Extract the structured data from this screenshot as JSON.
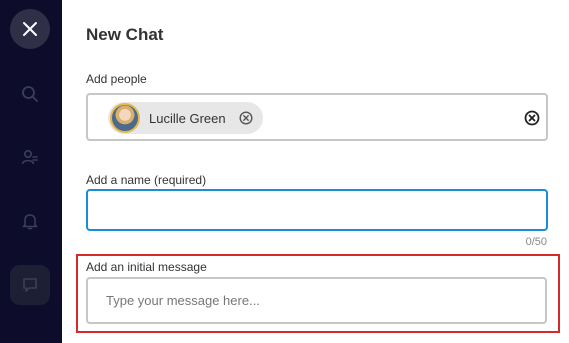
{
  "rail": {
    "items": [
      {
        "icon": "close-icon"
      },
      {
        "icon": "search-icon"
      },
      {
        "icon": "people-icon"
      },
      {
        "icon": "bell-icon"
      },
      {
        "icon": "chat-icon",
        "active": true
      }
    ]
  },
  "panel": {
    "title": "New Chat",
    "people": {
      "label": "Add people",
      "chips": [
        {
          "name": "Lucille Green"
        }
      ]
    },
    "name": {
      "label": "Add a name (required)",
      "value": "",
      "counter": "0/50"
    },
    "message": {
      "label": "Add an initial message",
      "placeholder": "Type your message here...",
      "value": ""
    }
  },
  "colors": {
    "rail_bg": "#0d0d2b",
    "focus_border": "#1a8cd8",
    "highlight_border": "#d42a2a",
    "chip_bg": "#e7e7e7"
  }
}
